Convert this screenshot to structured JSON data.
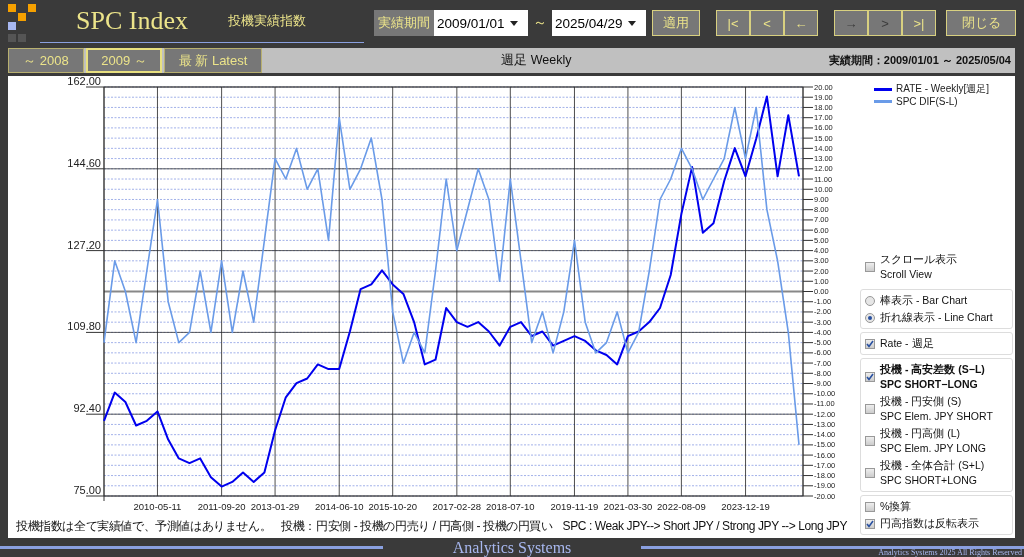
{
  "header": {
    "title": "SPC Index",
    "subtitle": "投機実績指数",
    "period_label": "実績期間",
    "date_from": "2009/01/01",
    "range_separator": "～",
    "date_to": "2025/04/29",
    "apply_button": "適用",
    "nav_groups": [
      [
        {
          "label": "|<",
          "disabled": false
        },
        {
          "label": "<",
          "disabled": false
        },
        {
          "label": "←",
          "disabled": false
        }
      ],
      [
        {
          "label": "→",
          "disabled": true
        },
        {
          "label": ">",
          "disabled": true
        },
        {
          "label": ">|",
          "disabled": false
        }
      ]
    ],
    "close_button": "閉じる"
  },
  "range_tabs": [
    {
      "label": "～ 2008",
      "selected": false
    },
    {
      "label": "2009 ～",
      "selected": true
    },
    {
      "label": "最 新  Latest",
      "selected": false
    }
  ],
  "chart_title": "週足 Weekly",
  "period_summary": "実績期間：2009/01/01 ～ 2025/05/04",
  "chart": {
    "chart_data": {
      "type": "line",
      "categories": [
        null,
        null,
        null,
        null,
        null,
        "2010-05-11",
        null,
        null,
        null,
        null,
        null,
        "2011-09-20",
        null,
        null,
        null,
        null,
        "2013-01-29",
        null,
        null,
        null,
        null,
        null,
        "2014-06-10",
        null,
        null,
        null,
        null,
        "2015-10-20",
        null,
        null,
        null,
        null,
        null,
        "2017-02-28",
        null,
        null,
        null,
        null,
        "2018-07-10",
        null,
        null,
        null,
        null,
        null,
        "2019-11-19",
        null,
        null,
        null,
        null,
        "2021-03-30",
        null,
        null,
        null,
        null,
        "2022-08-09",
        null,
        null,
        null,
        null,
        null,
        "2023-12-19",
        null,
        null,
        null,
        null,
        null
      ],
      "series": [
        {
          "name": "RATE - Weekly[週足]",
          "color": "#0000ee",
          "values": [
            91,
            97,
            95,
            90,
            91,
            93,
            87,
            83,
            82,
            83,
            79,
            77,
            78,
            80,
            78,
            80,
            89,
            96,
            99,
            100,
            103,
            102,
            102,
            110,
            119,
            120,
            123,
            120,
            118,
            112,
            103,
            104,
            115,
            112,
            111,
            112,
            110,
            107,
            111,
            112,
            109,
            110,
            107,
            108,
            109,
            108,
            106,
            105,
            103,
            109,
            110,
            112,
            115,
            122,
            135,
            145,
            131,
            133,
            142,
            149,
            143,
            151,
            160,
            143,
            156,
            143
          ]
        },
        {
          "name": "SPC DIF(S-L)",
          "color": "#6a9be8",
          "axis": "y2",
          "values": [
            -5,
            3,
            0,
            -5,
            2,
            9,
            -1,
            -5,
            -4,
            2,
            -4,
            3,
            -4,
            2,
            -3,
            5,
            13,
            11,
            14,
            10,
            12,
            5,
            17,
            10,
            12,
            15,
            9,
            -2,
            -7,
            -4,
            -6,
            2,
            11,
            4,
            8,
            12,
            9,
            1,
            11,
            3,
            -5,
            -2,
            -6,
            -2,
            5,
            -3,
            -6,
            -5,
            -2,
            -6,
            -4,
            2,
            9,
            11,
            14,
            12,
            9,
            11,
            13,
            18,
            13,
            18,
            8,
            3,
            -4,
            -15
          ]
        }
      ],
      "grid": true,
      "ylim": [
        75,
        162
      ],
      "yticks": [
        {
          "value": 75,
          "label": "75.00"
        },
        {
          "value": 92.4,
          "label": "92.40"
        },
        {
          "value": 109.8,
          "label": "109.80"
        },
        {
          "value": 127.2,
          "label": "127.20"
        },
        {
          "value": 144.6,
          "label": "144.60"
        },
        {
          "value": 162,
          "label": "162.00"
        }
      ],
      "y2lim": [
        -20,
        20
      ],
      "y2ticks": [
        {
          "value": -20,
          "label": "-20.00"
        },
        {
          "value": -19,
          "label": "-19.00"
        },
        {
          "value": -18,
          "label": "-18.00"
        },
        {
          "value": -17,
          "label": "-17.00"
        },
        {
          "value": -16,
          "label": "-16.00"
        },
        {
          "value": -15,
          "label": "-15.00"
        },
        {
          "value": -14,
          "label": "-14.00"
        },
        {
          "value": -13,
          "label": "-13.00"
        },
        {
          "value": -12,
          "label": "-12.00"
        },
        {
          "value": -11,
          "label": "-11.00"
        },
        {
          "value": -10,
          "label": "-10.00"
        },
        {
          "value": -9,
          "label": "-9.00"
        },
        {
          "value": -8,
          "label": "-8.00"
        },
        {
          "value": -7,
          "label": "-7.00"
        },
        {
          "value": -6,
          "label": "-6.00"
        },
        {
          "value": -5,
          "label": "-5.00"
        },
        {
          "value": -4,
          "label": "-4.00"
        },
        {
          "value": -3,
          "label": "-3.00"
        },
        {
          "value": -2,
          "label": "-2.00"
        },
        {
          "value": -1,
          "label": "-1.00"
        },
        {
          "value": 0,
          "label": "0.00"
        },
        {
          "value": 1,
          "label": "1.00"
        },
        {
          "value": 2,
          "label": "2.00"
        },
        {
          "value": 3,
          "label": "3.00"
        },
        {
          "value": 4,
          "label": "4.00"
        },
        {
          "value": 5,
          "label": "5.00"
        },
        {
          "value": 6,
          "label": "6.00"
        },
        {
          "value": 7,
          "label": "7.00"
        },
        {
          "value": 8,
          "label": "8.00"
        },
        {
          "value": 9,
          "label": "9.00"
        },
        {
          "value": 10,
          "label": "10.00"
        },
        {
          "value": 11,
          "label": "11.00"
        },
        {
          "value": 12,
          "label": "12.00"
        },
        {
          "value": 13,
          "label": "13.00"
        },
        {
          "value": 14,
          "label": "14.00"
        },
        {
          "value": 15,
          "label": "15.00"
        },
        {
          "value": 16,
          "label": "16.00"
        },
        {
          "value": 17,
          "label": "17.00"
        },
        {
          "value": 18,
          "label": "18.00"
        },
        {
          "value": 19,
          "label": "19.00"
        },
        {
          "value": 20,
          "label": "20.00"
        }
      ]
    }
  },
  "notes": [
    "投機指数は全て実績値で、予測値はありません。",
    "投機：円安側 - 投機の円売り / 円高側 - 投機の円買い",
    "SPC : Weak JPY--> Short JPY / Strong JPY --> Long JPY"
  ],
  "options": [
    {
      "items": [
        {
          "kind": "checkbox",
          "label": "スクロール表示",
          "sublabel": "Scroll View",
          "checked": false
        }
      ]
    },
    {
      "items": [
        {
          "kind": "radio",
          "label": "棒表示 - Bar Chart",
          "selected": false
        },
        {
          "kind": "radio",
          "label": "折れ線表示 - Line Chart",
          "selected": true
        }
      ]
    },
    {
      "items": [
        {
          "kind": "checkbox",
          "label": "Rate - 週足",
          "checked": true
        }
      ]
    },
    {
      "items": [
        {
          "kind": "checkbox",
          "label": "投機 - 高安差数 (S−L)",
          "sublabel": "SPC  SHORT−LONG",
          "checked": true,
          "bold": true
        },
        {
          "kind": "checkbox",
          "label": "投機 - 円安側 (S)",
          "sublabel": "SPC Elem. JPY SHORT",
          "checked": false,
          "bold": false
        },
        {
          "kind": "checkbox",
          "label": "投機 - 円高側 (L)",
          "sublabel": "SPC Elem. JPY LONG",
          "checked": false,
          "bold": false
        },
        {
          "kind": "checkbox",
          "label": "投機 - 全体合計 (S+L)",
          "sublabel": "SPC  SHORT+LONG",
          "checked": false,
          "bold": false
        }
      ]
    },
    {
      "items": [
        {
          "kind": "checkbox",
          "label": "%換算",
          "checked": false
        },
        {
          "kind": "checkbox",
          "label": "円高指数は反転表示",
          "checked": true
        }
      ]
    }
  ],
  "footer": {
    "brand": "Analytics Systems",
    "copyright": "Analytics Systems 2025 All Rights Reserved"
  }
}
